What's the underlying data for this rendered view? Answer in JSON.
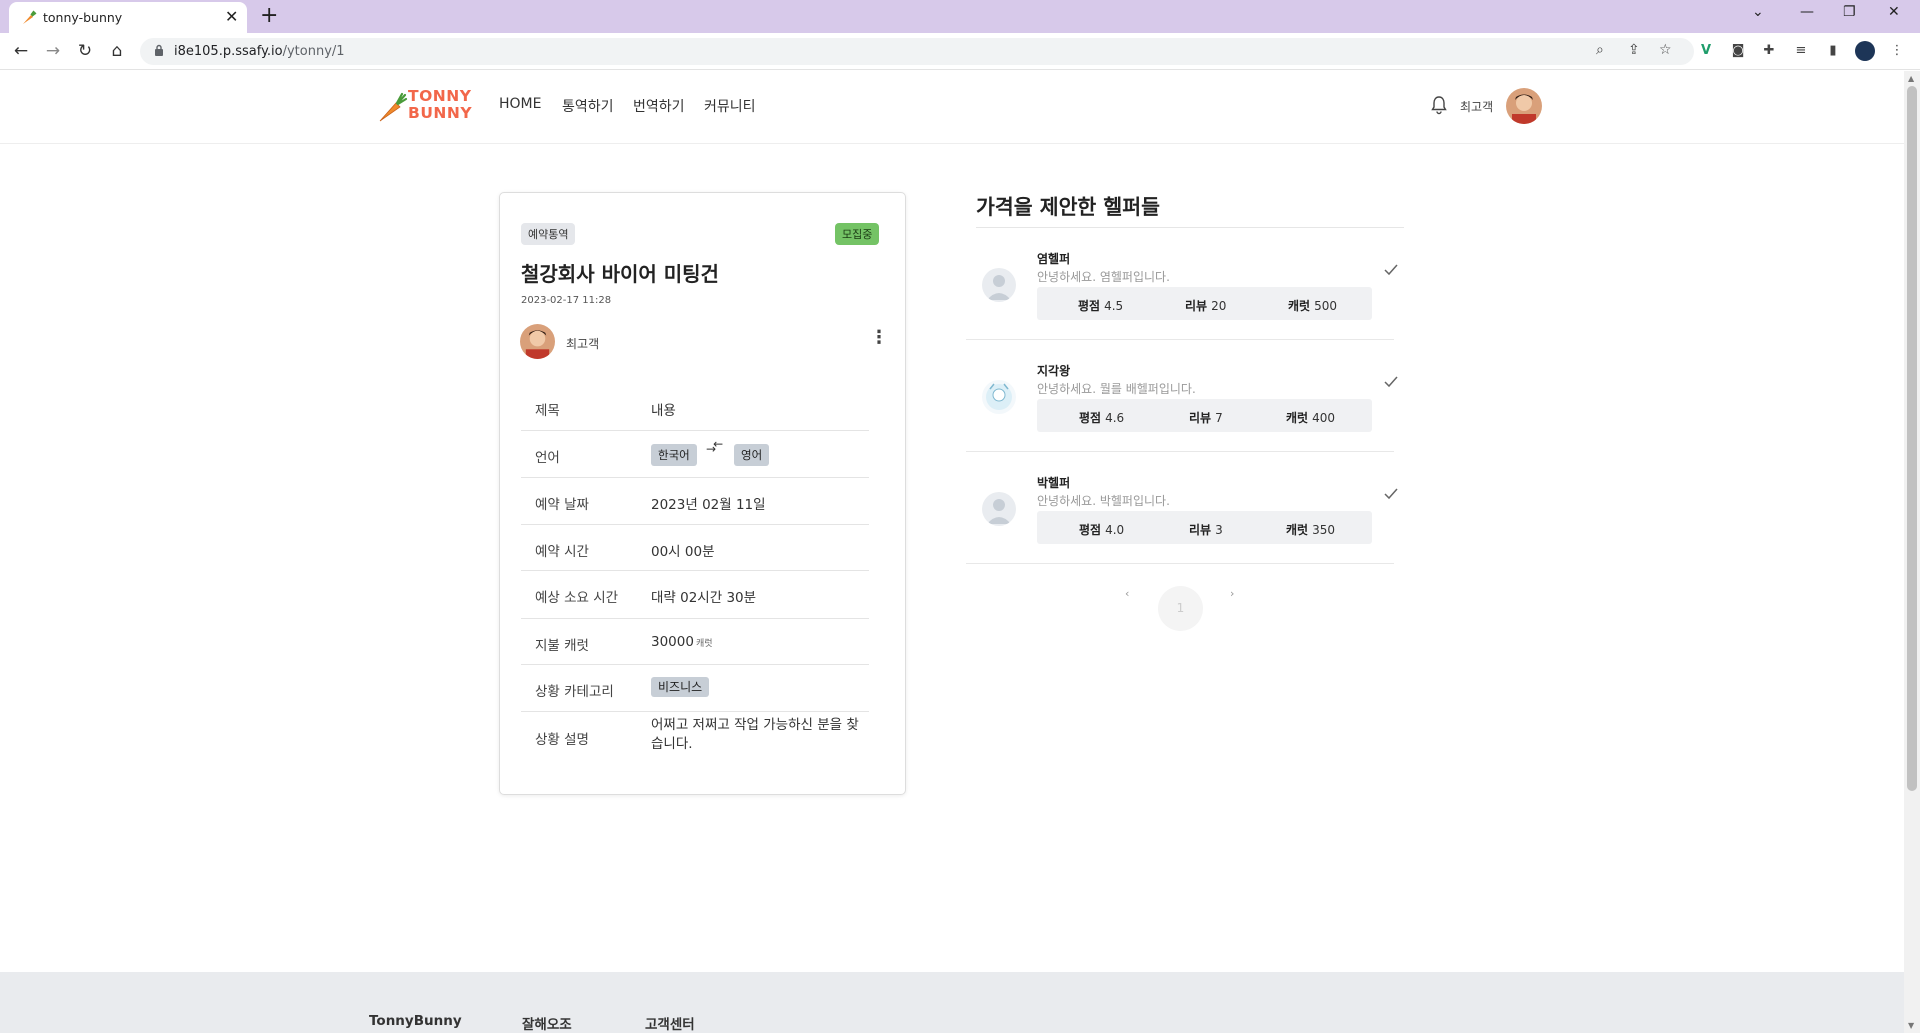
{
  "browser": {
    "tab_title": "tonny-bunny",
    "url_host": "i8e105.p.ssafy.io",
    "url_path": "/ytonny/1"
  },
  "header": {
    "logo_line1": "TONNY",
    "logo_line2": "BUNNY",
    "nav": [
      "HOME",
      "통역하기",
      "번역하기",
      "커뮤니티"
    ],
    "user_name": "최고객"
  },
  "request": {
    "type_chip": "예약통역",
    "status_chip": "모집중",
    "title": "철강회사 바이어 미팅건",
    "date": "2023-02-17 11:28",
    "author": "최고객",
    "table_header": {
      "label": "제목",
      "value": "내용"
    },
    "language": {
      "label": "언어",
      "from": "한국어",
      "to": "영어"
    },
    "reserve_date": {
      "label": "예약 날짜",
      "value": "2023년 02월 11일"
    },
    "reserve_time": {
      "label": "예약 시간",
      "value": "00시 00분"
    },
    "duration": {
      "label": "예상 소요 시간",
      "value": "대략 02시간 30분"
    },
    "pay": {
      "label": "지불 캐럿",
      "value": "30000",
      "unit": "캐럿"
    },
    "category": {
      "label": "상황 카테고리",
      "value": "비즈니스"
    },
    "description": {
      "label": "상황 설명",
      "value": "어쩌고 저쩌고 작업 가능하신 분을 찾습니다."
    }
  },
  "helpers_title": "가격을 제안한 헬퍼들",
  "helpers": [
    {
      "name": "염헬퍼",
      "greeting": "안녕하세요. 염헬퍼입니다.",
      "rating_label": "평점",
      "rating": "4.5",
      "review_label": "리뷰",
      "reviews": "20",
      "carrot_label": "캐럿",
      "carrot": "500"
    },
    {
      "name": "지각왕",
      "greeting": "안녕하세요. 뭘를 배헬퍼입니다.",
      "rating_label": "평점",
      "rating": "4.6",
      "review_label": "리뷰",
      "reviews": "7",
      "carrot_label": "캐럿",
      "carrot": "400"
    },
    {
      "name": "박헬퍼",
      "greeting": "안녕하세요. 박헬퍼입니다.",
      "rating_label": "평점",
      "rating": "4.0",
      "review_label": "리뷰",
      "reviews": "3",
      "carrot_label": "캐럿",
      "carrot": "350"
    }
  ],
  "pagination": {
    "prev": "‹",
    "current": "1",
    "next": "›"
  },
  "footer": [
    "TonnyBunny",
    "잘해오조",
    "고객센터"
  ],
  "colors": {
    "brand": "#f2674a",
    "status_green": "#74c365",
    "tab_bar": "#d7c9ea"
  }
}
